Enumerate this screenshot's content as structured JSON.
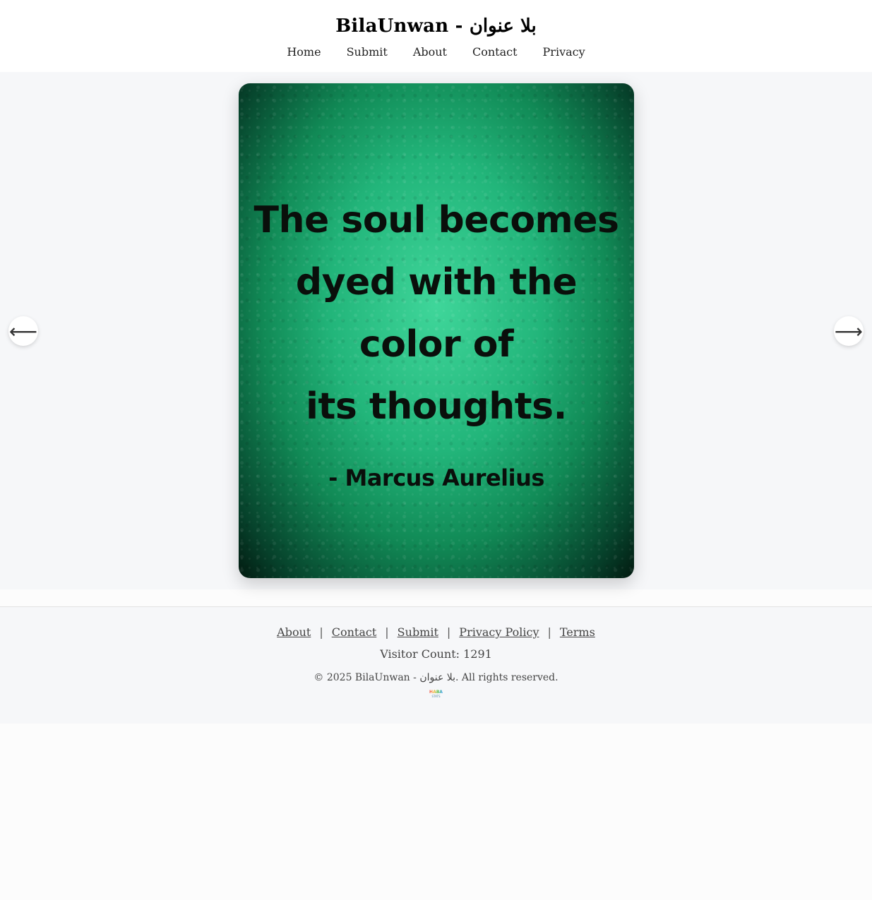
{
  "site": {
    "title": "BilaUnwan - بلا عنوان"
  },
  "nav": {
    "items": [
      "Home",
      "Submit",
      "About",
      "Contact",
      "Privacy"
    ]
  },
  "quote": {
    "lines": [
      "The soul becomes",
      "dyed with the",
      "color of",
      "its thoughts."
    ],
    "author": "- Marcus Aurelius"
  },
  "carousel": {
    "prev_icon": "arrow-left-icon",
    "next_icon": "arrow-right-icon",
    "prev_glyph": "⟵",
    "next_glyph": "⟶"
  },
  "footer": {
    "links": [
      "About",
      "Contact",
      "Submit",
      "Privacy Policy",
      "Terms"
    ],
    "separator": "|",
    "visitor_count": "Visitor Count: 1291",
    "copyright": "© 2025 BilaUnwan - بلا عنوان. All rights reserved.",
    "badge_top": "HABA",
    "badge_bottom": "STATS"
  },
  "colors": {
    "card_green": "#22b57a",
    "card_edge": "#06402a",
    "page_bg": "#f6f7f9"
  }
}
